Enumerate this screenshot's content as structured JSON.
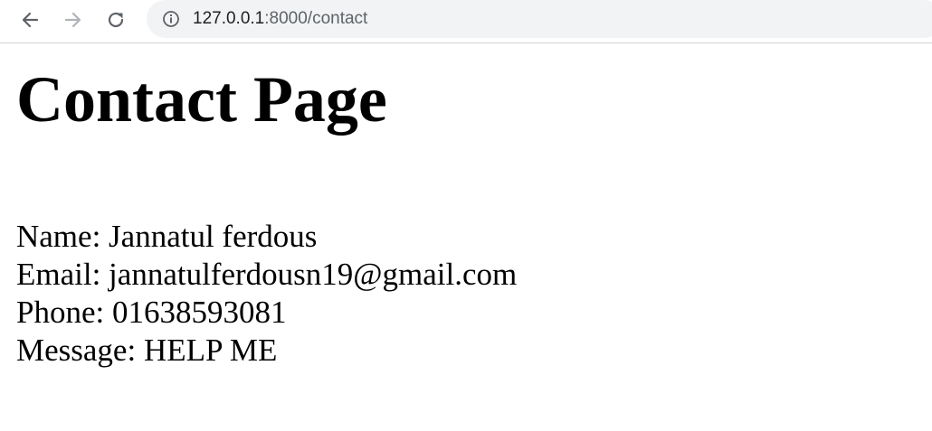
{
  "browser": {
    "url_host": "127.0.0.1",
    "url_rest": ":8000/contact"
  },
  "page": {
    "title": "Contact Page",
    "lines": {
      "name": "Name: Jannatul ferdous",
      "email": "Email: jannatulferdousn19@gmail.com",
      "phone": "Phone: 01638593081",
      "message": "Message: HELP ME"
    }
  },
  "icons": {
    "back": "arrow-left-icon",
    "forward": "arrow-right-icon",
    "reload": "reload-icon",
    "site_info": "info-icon"
  }
}
